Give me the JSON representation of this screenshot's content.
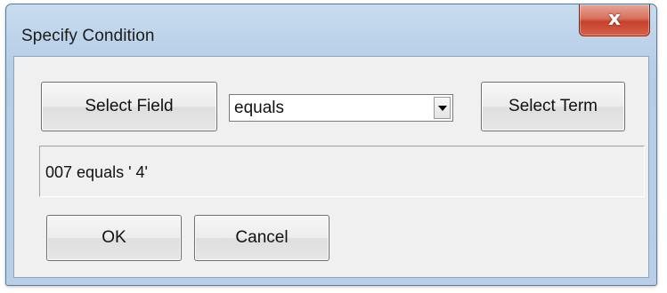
{
  "window": {
    "title": "Specify Condition",
    "close_glyph": "x"
  },
  "toolbar": {
    "select_field_label": "Select Field",
    "operator_value": "equals",
    "select_term_label": "Select Term"
  },
  "result": {
    "text": "007 equals ' 4'"
  },
  "footer": {
    "ok_label": "OK",
    "cancel_label": "Cancel"
  },
  "icons": {
    "close": "close-icon",
    "dropdown": "chevron-down-icon"
  },
  "colors": {
    "close_button": "#c7422c",
    "titlebar": "#bcd3ea",
    "client_background": "#f0f0f0"
  }
}
